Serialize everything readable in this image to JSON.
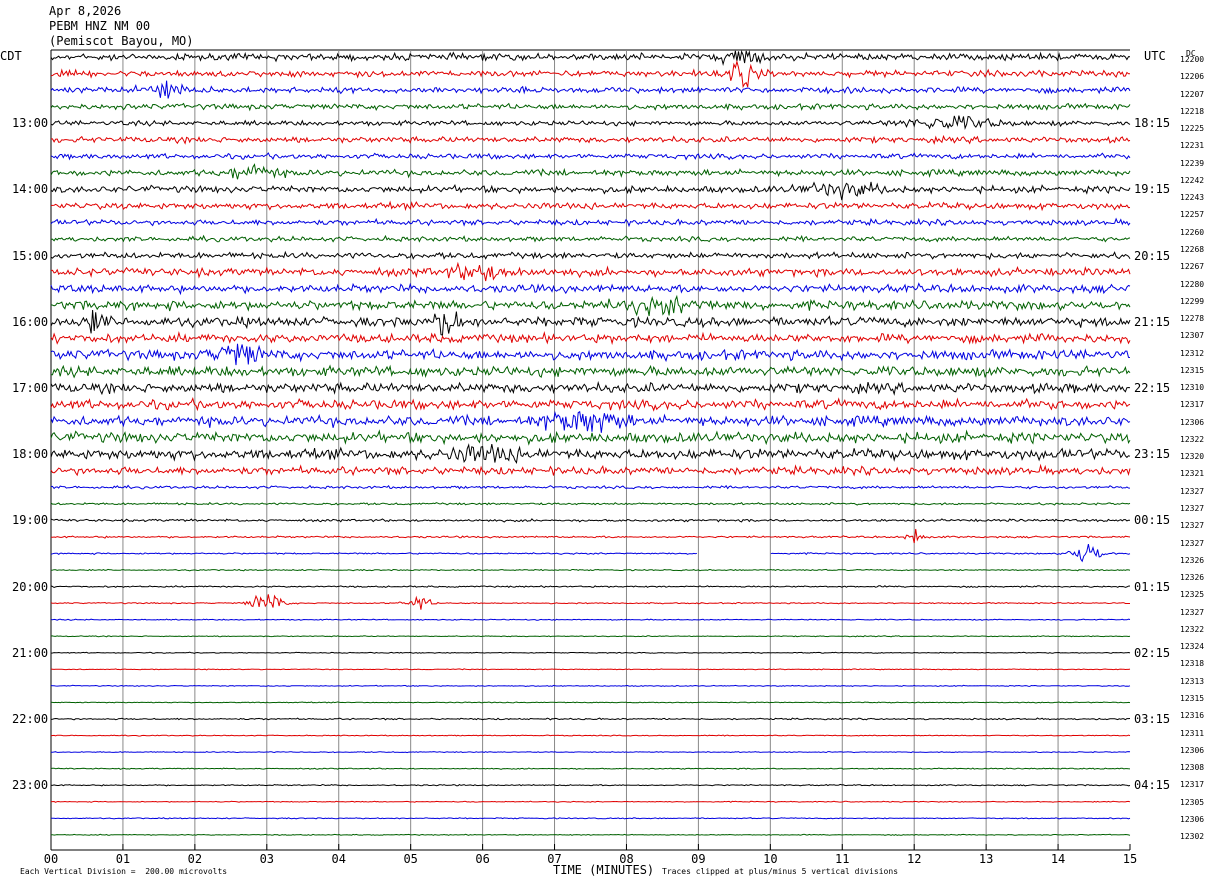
{
  "header": {
    "date": "Apr 8,2026",
    "station": "PEBM HNZ NM 00",
    "location": "(Pemiscot Bayou, MO)"
  },
  "left_zone": "CDT",
  "right_zone": "UTC",
  "dc_label": "DC",
  "footer": {
    "left_note": "Each Vertical Division =  200.00 microvolts",
    "axis_title": "TIME (MINUTES)",
    "right_note": "Traces clipped at plus/minus 5 vertical divisions"
  },
  "chart_data": {
    "type": "line",
    "title": "",
    "xlabel": "TIME (MINUTES)",
    "ylabel": "",
    "xlim": [
      0,
      15
    ],
    "x_ticks": [
      "00",
      "01",
      "02",
      "03",
      "04",
      "05",
      "06",
      "07",
      "08",
      "09",
      "10",
      "11",
      "12",
      "13",
      "14",
      "15"
    ],
    "trace_colors": [
      "#000000",
      "#e00000",
      "#0000e0",
      "#006000"
    ],
    "trace_count": 48,
    "traces_per_hour": 4,
    "left_hour_labels": [
      "13:00",
      "14:00",
      "15:00",
      "16:00",
      "17:00",
      "18:00",
      "19:00",
      "20:00",
      "21:00",
      "22:00",
      "23:00"
    ],
    "right_hour_labels": [
      "18:15",
      "19:15",
      "20:15",
      "21:15",
      "22:15",
      "23:15",
      "00:15",
      "01:15",
      "02:15",
      "03:15",
      "04:15"
    ],
    "dc_offsets": [
      "12200",
      "12206",
      "12207",
      "12218",
      "12225",
      "12231",
      "12239",
      "12242",
      "12243",
      "12257",
      "12260",
      "12268",
      "12267",
      "12280",
      "12299",
      "12278",
      "12307",
      "12312",
      "12315",
      "12310",
      "12317",
      "12306",
      "12322",
      "12320",
      "12321",
      "12327",
      "12327",
      "12327",
      "12327",
      "12326",
      "12326",
      "12325",
      "12327",
      "12322",
      "12324",
      "12318",
      "12313",
      "12315",
      "12316",
      "12311",
      "12306",
      "12308",
      "12317",
      "12305",
      "12306",
      "12302"
    ],
    "amplitude_by_trace": [
      2.2,
      2.0,
      1.9,
      1.8,
      1.6,
      1.9,
      1.7,
      2.0,
      2.2,
      2.1,
      1.8,
      1.6,
      2.0,
      2.5,
      2.6,
      3.0,
      3.1,
      2.9,
      3.2,
      3.3,
      3.2,
      3.1,
      3.3,
      3.4,
      3.4,
      2.6,
      0.9,
      0.7,
      0.8,
      0.6,
      0.5,
      0.4,
      0.5,
      0.4,
      0.35,
      0.3,
      0.3,
      0.28,
      0.3,
      0.3,
      0.5,
      0.3,
      0.3,
      0.35,
      0.4,
      0.3,
      0.35,
      0.3
    ],
    "gap": {
      "trace": 30,
      "x_start": 8.99,
      "x_end": 10.0
    }
  }
}
